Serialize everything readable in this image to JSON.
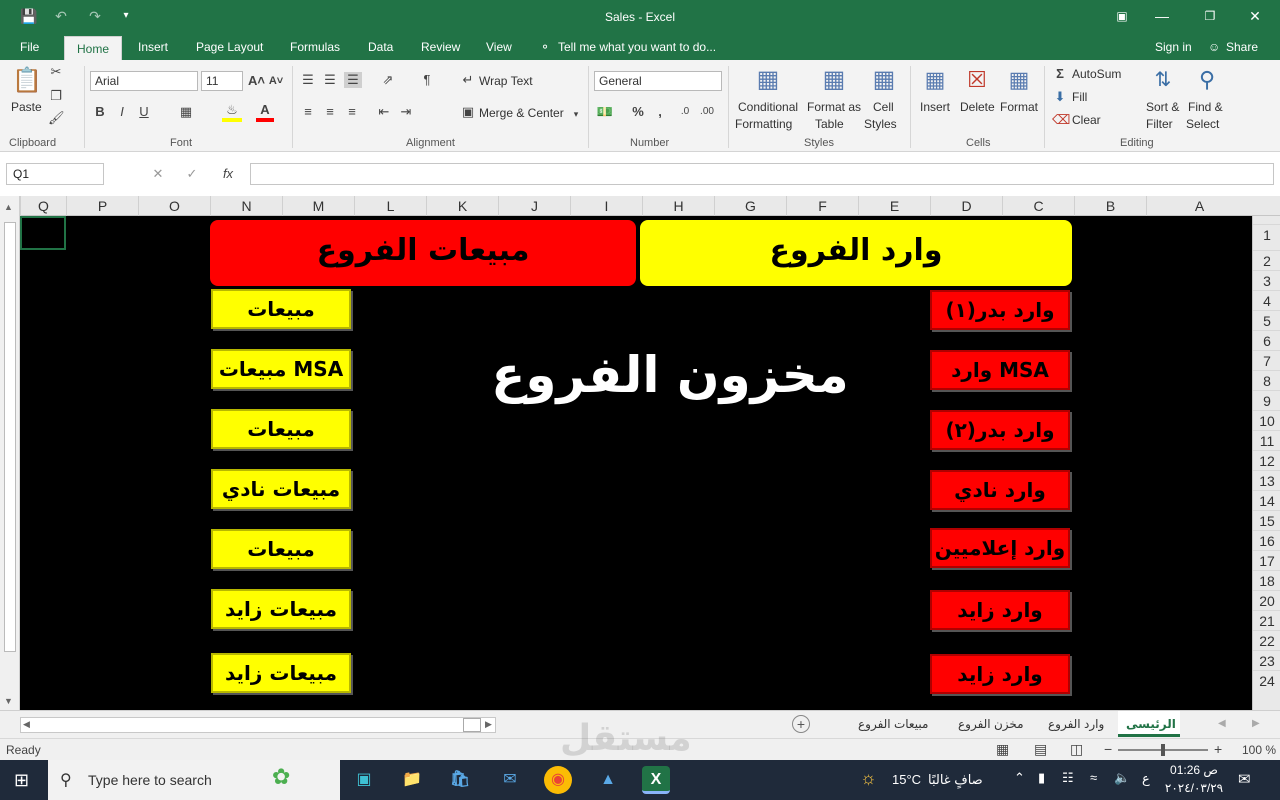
{
  "window": {
    "title": "Sales  -  Excel"
  },
  "tabs": [
    {
      "label": "File"
    },
    {
      "label": "Home"
    },
    {
      "label": "Insert"
    },
    {
      "label": "Page Layout"
    },
    {
      "label": "Formulas"
    },
    {
      "label": "Data"
    },
    {
      "label": "Review"
    },
    {
      "label": "View"
    }
  ],
  "tell_me": "Tell me what you want to do...",
  "sign_in": "Sign in",
  "share": "Share",
  "ribbon": {
    "clipboard": {
      "label": "Clipboard",
      "paste": "Paste"
    },
    "font": {
      "label": "Font",
      "name": "Arial",
      "size": "11",
      "bold": "B",
      "italic": "I",
      "underline": "U"
    },
    "alignment": {
      "label": "Alignment",
      "wrap": "Wrap Text",
      "merge": "Merge & Center"
    },
    "number": {
      "label": "Number",
      "format": "General"
    },
    "styles": {
      "label": "Styles",
      "conditional": [
        "Conditional",
        "Formatting"
      ],
      "format_table": [
        "Format as",
        "Table"
      ],
      "cell_styles": [
        "Cell",
        "Styles"
      ]
    },
    "cells": {
      "label": "Cells",
      "insert": "Insert",
      "delete": "Delete",
      "format": "Format"
    },
    "editing": {
      "label": "Editing",
      "autosum": "AutoSum",
      "fill": "Fill",
      "clear": "Clear",
      "sort": [
        "Sort &",
        "Filter"
      ],
      "find": [
        "Find &",
        "Select"
      ]
    }
  },
  "formula_bar": {
    "name_box": "Q1",
    "fx": "fx",
    "value": ""
  },
  "columns": [
    "Q",
    "P",
    "O",
    "N",
    "M",
    "L",
    "K",
    "J",
    "I",
    "H",
    "G",
    "F",
    "E",
    "D",
    "C",
    "B",
    "A"
  ],
  "rows": [
    "1",
    "2",
    "3",
    "4",
    "5",
    "6",
    "7",
    "8",
    "9",
    "10",
    "11",
    "12",
    "13",
    "14",
    "15",
    "16",
    "17",
    "18",
    "20",
    "21",
    "22",
    "23",
    "24"
  ],
  "sheet": {
    "banner_sales": "مبيعات الفروع",
    "banner_incoming": "وارد الفروع",
    "big_title": "مخزون الفروع",
    "sales_buttons": [
      "مبيعات",
      "مبيعات MSA",
      "مبيعات",
      "مبيعات نادي",
      "مبيعات",
      "مبيعات زايد",
      "مبيعات زايد"
    ],
    "incoming_buttons": [
      "وارد بدر(١)",
      "وارد MSA",
      "وارد بدر(٢)",
      "وارد نادي",
      "وارد إعلاميين",
      "وارد زايد",
      "وارد زايد"
    ]
  },
  "sheet_tabs": [
    "مبيعات الفروع",
    "مخزن الفروع",
    "وارد الفروع",
    "الرئيسى"
  ],
  "status": {
    "ready": "Ready",
    "zoom": "100 %"
  },
  "taskbar": {
    "search_placeholder": "Type here to search",
    "weather_temp": "15°C",
    "weather_text": "صافٍ غالبًا",
    "lang": "ع",
    "time": "01:26 ص",
    "date": "٢٠٢٤/٠٣/٢٩"
  },
  "colors": {
    "excel_green": "#217346",
    "yellow": "#ffff00",
    "red": "#ff0000"
  }
}
